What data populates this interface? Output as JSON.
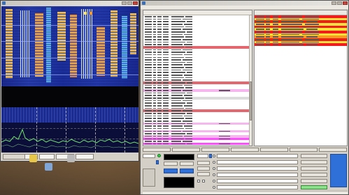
{
  "waterfall_window": {
    "title": "",
    "controls": [
      "",
      "",
      "",
      "",
      "",
      "",
      ""
    ]
  },
  "decoder_window": {
    "title": "",
    "menu": [
      "",
      "",
      "",
      "",
      "",
      "",
      "",
      ""
    ],
    "messages": {
      "header": "",
      "rows": [
        {
          "style": "plain",
          "text": ""
        },
        {
          "style": "plain",
          "text": ""
        },
        {
          "style": "plain",
          "text": ""
        },
        {
          "style": "plain",
          "text": ""
        },
        {
          "style": "plain",
          "text": ""
        },
        {
          "style": "plain",
          "text": ""
        },
        {
          "style": "plain",
          "text": ""
        },
        {
          "style": "plain",
          "text": ""
        },
        {
          "style": "plain",
          "text": ""
        },
        {
          "style": "plain",
          "text": ""
        },
        {
          "style": "plain",
          "text": ""
        },
        {
          "style": "plain",
          "text": ""
        },
        {
          "style": "sep",
          "text": ""
        },
        {
          "style": "plain",
          "text": ""
        },
        {
          "style": "plain",
          "text": ""
        },
        {
          "style": "plain",
          "text": ""
        },
        {
          "style": "plain",
          "text": ""
        },
        {
          "style": "plain",
          "text": ""
        },
        {
          "style": "plain",
          "text": ""
        },
        {
          "style": "plain",
          "text": ""
        },
        {
          "style": "plain",
          "text": ""
        },
        {
          "style": "plain",
          "text": ""
        },
        {
          "style": "plain",
          "text": ""
        },
        {
          "style": "plain",
          "text": ""
        },
        {
          "style": "plain",
          "text": ""
        },
        {
          "style": "plain",
          "text": ""
        },
        {
          "style": "sep",
          "text": ""
        },
        {
          "style": "plain",
          "text": ""
        },
        {
          "style": "plain",
          "text": ""
        },
        {
          "style": "pink",
          "text": ""
        },
        {
          "style": "plain",
          "text": ""
        },
        {
          "style": "plain",
          "text": ""
        },
        {
          "style": "gray",
          "text": ""
        },
        {
          "style": "plain",
          "text": ""
        },
        {
          "style": "plain",
          "text": ""
        },
        {
          "style": "plain",
          "text": ""
        },
        {
          "style": "plain",
          "text": ""
        },
        {
          "style": "sep",
          "text": ""
        },
        {
          "style": "plain",
          "text": ""
        },
        {
          "style": "plain",
          "text": ""
        },
        {
          "style": "plain",
          "text": ""
        },
        {
          "style": "plain",
          "text": ""
        },
        {
          "style": "pink",
          "text": ""
        },
        {
          "style": "plain",
          "text": ""
        },
        {
          "style": "plain",
          "text": ""
        },
        {
          "style": "pink",
          "text": ""
        },
        {
          "style": "plain",
          "text": ""
        },
        {
          "style": "pink",
          "text": ""
        },
        {
          "style": "magenta",
          "text": ""
        },
        {
          "style": "plain",
          "text": ""
        },
        {
          "style": "magenta",
          "text": ""
        }
      ]
    },
    "band_activity": {
      "header": "",
      "rows": [
        {
          "style": "red",
          "text": ""
        },
        {
          "style": "yellow",
          "text": ""
        },
        {
          "style": "red",
          "text": ""
        },
        {
          "style": "yellow",
          "text": ""
        },
        {
          "style": "red",
          "text": ""
        },
        {
          "style": "yellow",
          "text": ""
        },
        {
          "style": "red",
          "text": ""
        },
        {
          "style": "yellow",
          "text": ""
        },
        {
          "style": "orange",
          "text": ""
        },
        {
          "style": "red",
          "text": ""
        },
        {
          "style": "yellow",
          "text": ""
        },
        {
          "style": "red",
          "text": ""
        }
      ]
    },
    "controls": {
      "tx_labels": [
        "",
        "",
        "",
        "",
        "",
        "",
        ""
      ],
      "frequency": "",
      "mode_buttons": [
        "",
        ""
      ],
      "clock_date": "",
      "clock_time": "",
      "dx_labels": [
        "",
        "",
        ""
      ],
      "message_fields": [
        "",
        "",
        "",
        "",
        "",
        ""
      ],
      "side_buttons": [
        "",
        "",
        "",
        "",
        "",
        ""
      ]
    }
  },
  "desktop": {
    "icons": [
      "folder-icon",
      "app-icon",
      "gear-icon"
    ]
  }
}
